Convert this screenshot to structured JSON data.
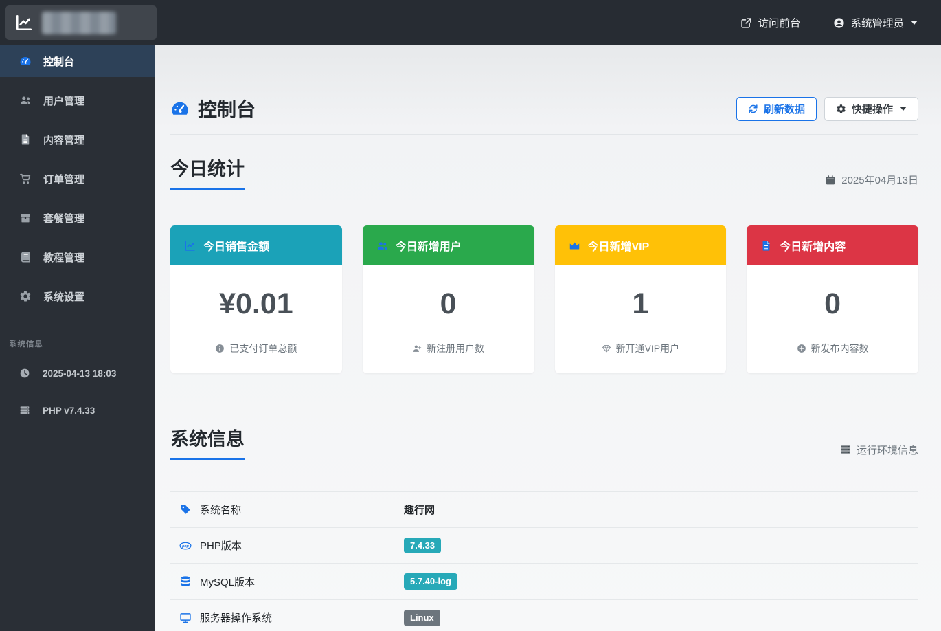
{
  "colors": {
    "accent_blue": "#1a73e8",
    "navbar_bg": "#272c33",
    "sidebar_bg": "#2a2f36",
    "active_item_bg": "#2d4158",
    "card_teal": "#1ba2b8",
    "card_green": "#2aa94c",
    "card_yellow": "#ffc107",
    "card_red": "#dc3545",
    "badge_info": "#27a9b8",
    "badge_secondary": "#6c757d"
  },
  "navbar": {
    "visit_front_label": "访问前台",
    "admin_label": "系统管理员"
  },
  "sidebar": {
    "menu": [
      {
        "label": "控制台",
        "icon": "tachometer-icon",
        "active": true
      },
      {
        "label": "用户管理",
        "icon": "users-icon"
      },
      {
        "label": "内容管理",
        "icon": "file-icon"
      },
      {
        "label": "订单管理",
        "icon": "cart-icon"
      },
      {
        "label": "套餐管理",
        "icon": "box-icon"
      },
      {
        "label": "教程管理",
        "icon": "book-icon"
      },
      {
        "label": "系统设置",
        "icon": "gear-icon"
      }
    ],
    "info_heading": "系统信息",
    "info_items": [
      {
        "label": "2025-04-13 18:03",
        "icon": "clock-icon"
      },
      {
        "label": "PHP v7.4.33",
        "icon": "server-icon"
      }
    ]
  },
  "page": {
    "title": "控制台",
    "refresh_label": "刷新数据",
    "quick_actions_label": "快捷操作"
  },
  "today": {
    "section_title": "今日统计",
    "date": "2025年04月13日",
    "cards": [
      {
        "header": "今日销售金额",
        "value": "¥0.01",
        "footer": "已支付订单总额",
        "color": "#1ba2b8"
      },
      {
        "header": "今日新增用户",
        "value": "0",
        "footer": "新注册用户数",
        "color": "#2aa94c"
      },
      {
        "header": "今日新增VIP",
        "value": "1",
        "footer": "新开通VIP用户",
        "color": "#ffc107"
      },
      {
        "header": "今日新增内容",
        "value": "0",
        "footer": "新发布内容数",
        "color": "#dc3545"
      }
    ]
  },
  "system": {
    "section_title": "系统信息",
    "env_label": "运行环境信息",
    "rows": [
      {
        "label": "系统名称",
        "value": "趣行网",
        "value_type": "text"
      },
      {
        "label": "PHP版本",
        "value": "7.4.33",
        "value_type": "badge-info"
      },
      {
        "label": "MySQL版本",
        "value": "5.7.40-log",
        "value_type": "badge-info"
      },
      {
        "label": "服务器操作系统",
        "value": "Linux",
        "value_type": "badge-secondary"
      }
    ]
  }
}
